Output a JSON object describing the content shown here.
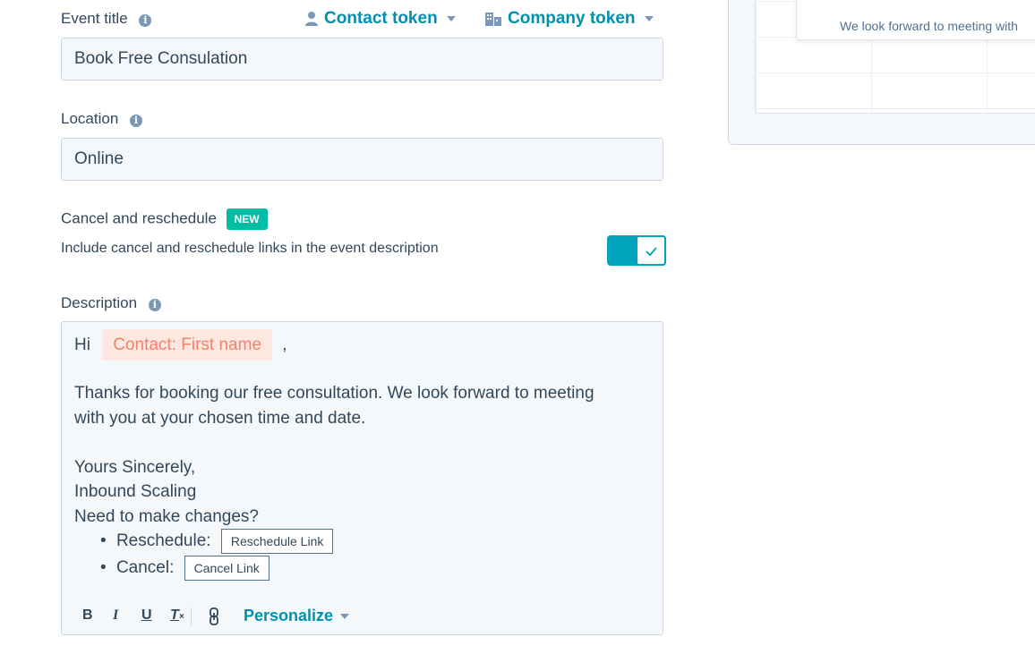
{
  "form": {
    "event_title": {
      "label": "Event title",
      "value": "Book Free Consulation"
    },
    "tokens": {
      "contact_label": "Contact token",
      "company_label": "Company token"
    },
    "location": {
      "label": "Location",
      "value": "Online"
    },
    "cancel_reschedule": {
      "label": "Cancel and reschedule",
      "badge": "NEW",
      "description": "Include cancel and reschedule links in the event description",
      "enabled": true
    },
    "description": {
      "label": "Description",
      "greeting": "Hi",
      "token_chip": "Contact: First name",
      "comma": ",",
      "line1": "Thanks for booking our free consultation. We look forward to meeting",
      "line2": "with you at your chosen time and date.",
      "line3": "Yours Sincerely,",
      "line4": "Inbound Scaling",
      "line5": "Need to make changes?",
      "reschedule_label": "Reschedule:",
      "reschedule_link": "Reschedule Link",
      "cancel_label": "Cancel:",
      "cancel_link": "Cancel Link"
    },
    "toolbar": {
      "bold": "B",
      "italic": "I",
      "underline": "U",
      "clear": "T",
      "personalize": "Personalize"
    }
  },
  "preview": {
    "text": "We look forward to meeting with"
  },
  "colors": {
    "accent": "#0091ae",
    "toggle": "#00a4bd",
    "badge": "#00bda5",
    "token_chip_bg": "#fde8e1",
    "token_chip_text": "#f2826a"
  }
}
